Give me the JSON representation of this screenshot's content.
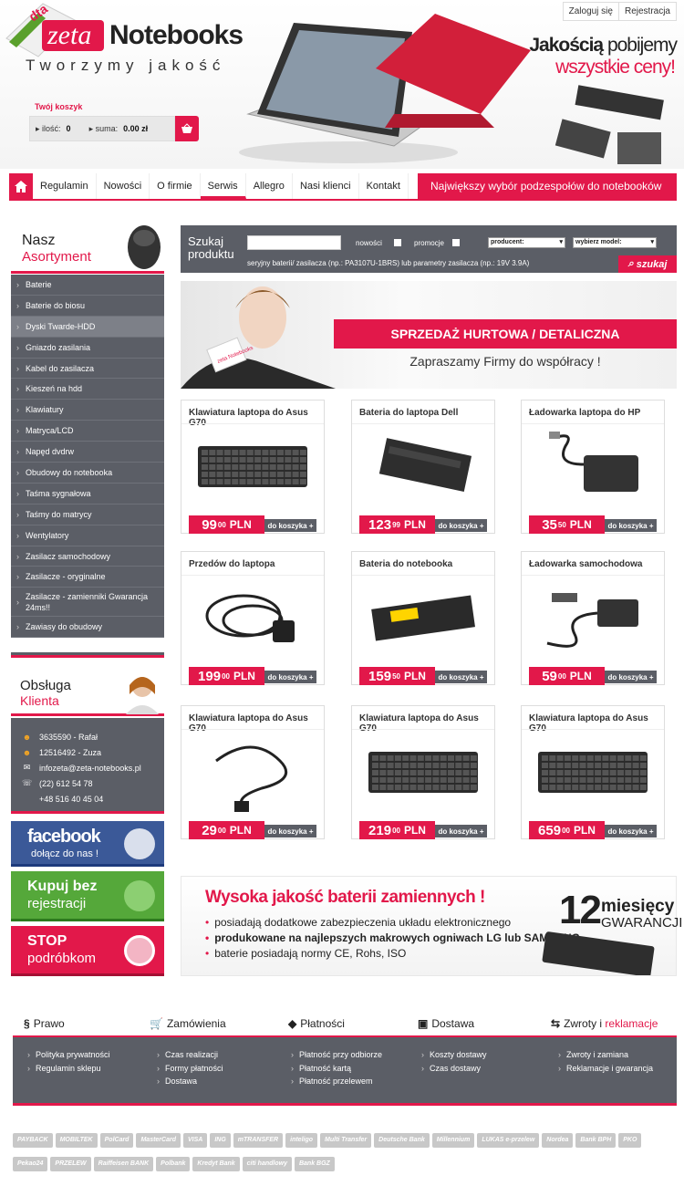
{
  "header": {
    "logo_badge": "dta",
    "logo_prefix": "zeta",
    "logo_name": "Notebooks",
    "slogan": "Tworzymy jakość",
    "top_links": [
      "Zaloguj się",
      "Rejestracja"
    ],
    "tagline_bold": "Jakością",
    "tagline_rest": " pobijemy",
    "tagline_line2": "wszystkie ceny!"
  },
  "cart": {
    "title": "Twój koszyk",
    "qty_label": "ilość:",
    "qty": "0",
    "sum_label": "suma:",
    "sum": "0.00 zł"
  },
  "nav": {
    "items": [
      "Regulamin",
      "Nowości",
      "O firmie",
      "Serwis",
      "Allegro",
      "Nasi klienci",
      "Kontakt"
    ],
    "active": "Serwis",
    "promo": "Największy wybór podzespołów do notebooków"
  },
  "sidebar": {
    "asort_title1": "Nasz",
    "asort_title2": "Asortyment",
    "categories": [
      "Baterie",
      "Baterie do biosu",
      "Dyski Twarde-HDD",
      "Gniazdo zasilania",
      "Kabel do zasilacza",
      "Kieszeń na hdd",
      "Klawiatury",
      "Matryca/LCD",
      "Napęd dvdrw",
      "Obudowy do notebooka",
      "Taśma sygnałowa",
      "Taśmy do matrycy",
      "Wentylatory",
      "Zasilacz samochodowy",
      "Zasilacze - oryginalne",
      "Zasilacze - zamienniki Gwarancja 24ms!!",
      "Zawiasy do obudowy"
    ],
    "active_category": "Dyski Twarde-HDD",
    "service_title1": "Obsługa",
    "service_title2": "Klienta",
    "contacts": [
      "3635590 - Rafał",
      "12516492 - Zuza",
      "infozeta@zeta-notebooks.pl",
      "(22) 612 54 78",
      "+48 516 40 45 04"
    ],
    "facebook_title": "facebook",
    "facebook_sub": "dołącz do nas !",
    "buy_title": "Kupuj bez",
    "buy_sub": "rejestracji",
    "stop_title": "STOP",
    "stop_sub": "podróbkom"
  },
  "search": {
    "label1": "Szukaj",
    "label2": "produktu",
    "new_label": "nowości",
    "promo_label": "promocje",
    "producer": "producent:",
    "model": "wybierz model:",
    "hint": "seryjny baterii/ zasilacza (np.: PA3107U-1BRS) lub parametry zasilacza (np.: 19V 3.9A)",
    "button": "szukaj"
  },
  "banner": {
    "strip": "SPRZEDAŻ HURTOWA / DETALICZNA",
    "sub": "Zapraszamy Firmy do współracy !",
    "card_text": "zeta Notebooks"
  },
  "products": [
    {
      "title": "Klawiatura laptopa do Asus G70",
      "price_int": "99",
      "price_dec": "00",
      "currency": "PLN",
      "cart": "do koszyka +",
      "kind": "keyboard"
    },
    {
      "title": "Bateria do laptopa Dell",
      "price_int": "123",
      "price_dec": "99",
      "currency": "PLN",
      "cart": "do koszyka +",
      "kind": "battery"
    },
    {
      "title": "Ładowarka laptopa do HP",
      "price_int": "35",
      "price_dec": "50",
      "currency": "PLN",
      "cart": "do koszyka +",
      "kind": "charger"
    },
    {
      "title": "Przedów do laptopa",
      "price_int": "199",
      "price_dec": "00",
      "currency": "PLN",
      "cart": "do koszyka +",
      "kind": "cable"
    },
    {
      "title": "Bateria do notebooka",
      "price_int": "159",
      "price_dec": "50",
      "currency": "PLN",
      "cart": "do koszyka +",
      "kind": "battery2"
    },
    {
      "title": "Ładowarka samochodowa",
      "price_int": "59",
      "price_dec": "00",
      "currency": "PLN",
      "cart": "do koszyka +",
      "kind": "carcharger"
    },
    {
      "title": "Klawiatura laptopa do Asus G70",
      "price_int": "29",
      "price_dec": "00",
      "currency": "PLN",
      "cart": "do koszyka +",
      "kind": "cable2"
    },
    {
      "title": "Klawiatura laptopa do Asus G70",
      "price_int": "219",
      "price_dec": "00",
      "currency": "PLN",
      "cart": "do koszyka +",
      "kind": "keyboard"
    },
    {
      "title": "Klawiatura laptopa do Asus G70",
      "price_int": "659",
      "price_dec": "00",
      "currency": "PLN",
      "cart": "do koszyka +",
      "kind": "keyboard"
    }
  ],
  "quality": {
    "title": "Wysoka jakość baterii zamiennych !",
    "bullets": [
      "posiadają dodatkowe zabezpieczenia układu elektronicznego",
      "produkowane na najlepszych makrowych ogniwach LG lub SAMSUNG",
      "baterie posiadają normy CE, Rohs, ISO"
    ],
    "months_num": "12",
    "months": "miesięcy",
    "warranty": "GWARANCJI"
  },
  "footer": {
    "tabs": [
      {
        "icon": "§",
        "label": "Prawo"
      },
      {
        "icon": "🛒",
        "label": "Zamówienia"
      },
      {
        "icon": "◆",
        "label": "Płatności"
      },
      {
        "icon": "▣",
        "label": "Dostawa"
      },
      {
        "icon": "⇆",
        "label": "Zwroty i ",
        "label2": "reklamacje"
      }
    ],
    "cols": [
      [
        "Polityka prywatności",
        "Regulamin sklepu"
      ],
      [
        "Czas realizacji",
        "Formy płatności",
        "Dostawa"
      ],
      [
        "Płatność przy odbiorze",
        "Płatność kartą",
        "Płatność przelewem"
      ],
      [
        "Koszty dostawy",
        "Czas dostawy"
      ],
      [
        "Zwroty i zamiana",
        "Reklamacje i gwarancja"
      ]
    ]
  },
  "payments": [
    "PAYBACK",
    "MOBILTEK",
    "PolCard",
    "MasterCard",
    "VISA",
    "ING",
    "mTRANSFER",
    "inteligo",
    "Multi Transfer",
    "Deutsche Bank",
    "Millennium",
    "LUKAS e-przelew",
    "Nordea",
    "Bank BPH",
    "PKO",
    "Pekao24",
    "PRZELEW",
    "Raiffeisen BANK",
    "Polbank",
    "Kredyt Bank",
    "citi handlowy",
    "Bank BGZ"
  ],
  "colors": {
    "accent": "#e2184a",
    "panel": "#5b5e66"
  }
}
